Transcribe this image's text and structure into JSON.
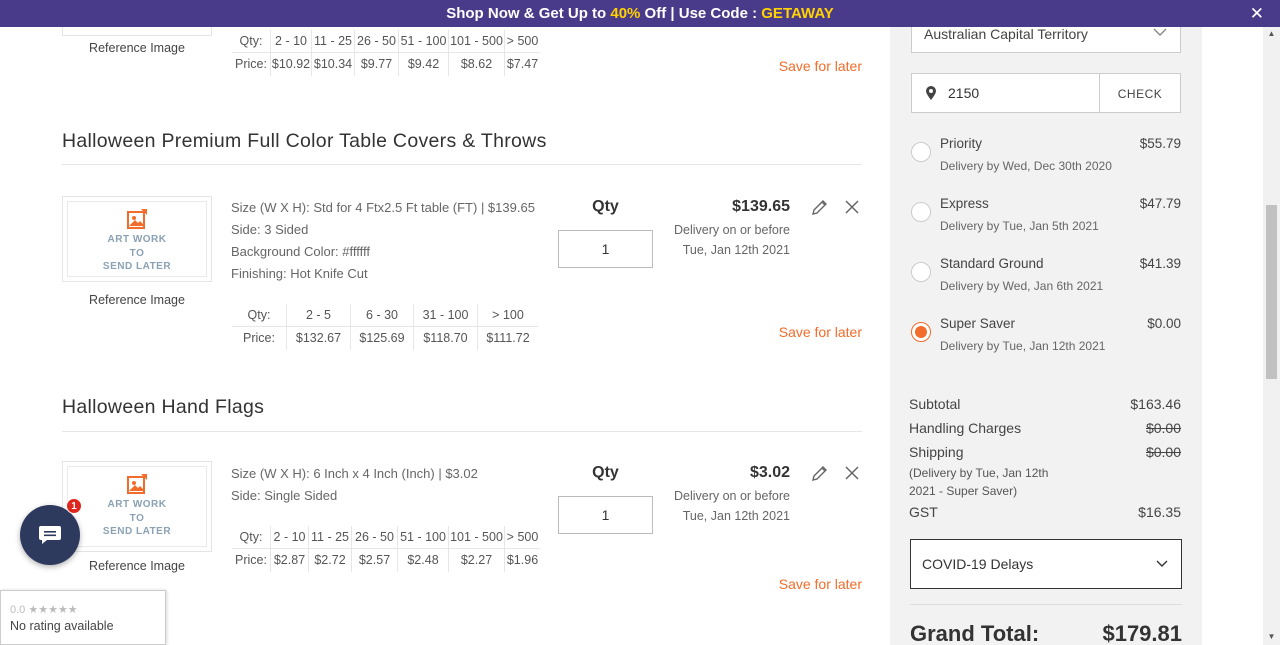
{
  "banner": {
    "prefix": "Shop Now & Get Up to ",
    "highlight_pct": "40%",
    "middle": " Off | Use Code : ",
    "code": "GETAWAY",
    "close_glyph": "✕"
  },
  "items": [
    {
      "ref_label": "Reference Image",
      "tiers": {
        "qty_label": "Qty:",
        "price_label": "Price:",
        "qtys": [
          "2 - 10",
          "11 - 25",
          "26 - 50",
          "51 - 100",
          "101 - 500",
          "> 500"
        ],
        "prices": [
          "$10.92",
          "$10.34",
          "$9.77",
          "$9.42",
          "$8.62",
          "$7.47"
        ]
      },
      "save_later": "Save for later"
    },
    {
      "title": "Halloween Premium Full Color Table Covers & Throws",
      "art_lines": [
        "ART WORK",
        "TO",
        "SEND LATER"
      ],
      "ref_label": "Reference Image",
      "specs": [
        "Size (W X H): Std for 4 Ftx2.5 Ft table (FT) | $139.65",
        "Side: 3 Sided",
        "Background Color: #ffffff",
        "Finishing: Hot Knife Cut"
      ],
      "qty_label": "Qty",
      "qty_value": "1",
      "price": "$139.65",
      "delivery_line1": "Delivery on or before",
      "delivery_line2": "Tue, Jan 12th 2021",
      "tiers": {
        "qty_label": "Qty:",
        "price_label": "Price:",
        "qtys": [
          "2 - 5",
          "6 - 30",
          "31 - 100",
          "> 100"
        ],
        "prices": [
          "$132.67",
          "$125.69",
          "$118.70",
          "$111.72"
        ]
      },
      "save_later": "Save for later"
    },
    {
      "title": "Halloween Hand Flags",
      "art_lines": [
        "ART WORK",
        "TO",
        "SEND LATER"
      ],
      "ref_label": "Reference Image",
      "specs": [
        "Size (W X H): 6 Inch x 4 Inch (Inch) | $3.02",
        "Side: Single Sided"
      ],
      "qty_label": "Qty",
      "qty_value": "1",
      "price": "$3.02",
      "delivery_line1": "Delivery on or before",
      "delivery_line2": "Tue, Jan 12th 2021",
      "tiers": {
        "qty_label": "Qty:",
        "price_label": "Price:",
        "qtys": [
          "2 - 10",
          "11 - 25",
          "26 - 50",
          "51 - 100",
          "101 - 500",
          "> 500"
        ],
        "prices": [
          "$2.87",
          "$2.72",
          "$2.57",
          "$2.48",
          "$2.27",
          "$1.96"
        ]
      },
      "save_later": "Save for later"
    }
  ],
  "chat": {
    "badge_count": "1"
  },
  "rating": {
    "score": "0.0",
    "stars": "★★★★★",
    "text": "No rating available"
  },
  "shipping": {
    "region": "Australian Capital Territory",
    "postcode": "2150",
    "check_label": "CHECK",
    "options": [
      {
        "name": "Priority",
        "cost": "$55.79",
        "delivery": "Delivery by Wed, Dec 30th 2020",
        "selected": false
      },
      {
        "name": "Express",
        "cost": "$47.79",
        "delivery": "Delivery by Tue, Jan 5th 2021",
        "selected": false
      },
      {
        "name": "Standard Ground",
        "cost": "$41.39",
        "delivery": "Delivery by Wed, Jan 6th 2021",
        "selected": false
      },
      {
        "name": "Super Saver",
        "cost": "$0.00",
        "delivery": "Delivery by Tue, Jan 12th 2021",
        "selected": true
      }
    ]
  },
  "summary": {
    "subtotal_label": "Subtotal",
    "subtotal": "$163.46",
    "handling_label": "Handling Charges",
    "handling": "$0.00",
    "shipping_label": "Shipping",
    "shipping": "$0.00",
    "shipping_note_1": "(Delivery by Tue, Jan 12th",
    "shipping_note_2": "2021 - Super Saver)",
    "gst_label": "GST",
    "gst": "$16.35",
    "covid_label": "COVID-19 Delays",
    "grand_label": "Grand Total:",
    "grand_total": "$179.81"
  },
  "colors": {
    "accent": "#f26c2b",
    "banner_bg": "#4a3a8a",
    "banner_highlight": "#ffd200",
    "chat_bg": "#2d3a5e"
  }
}
